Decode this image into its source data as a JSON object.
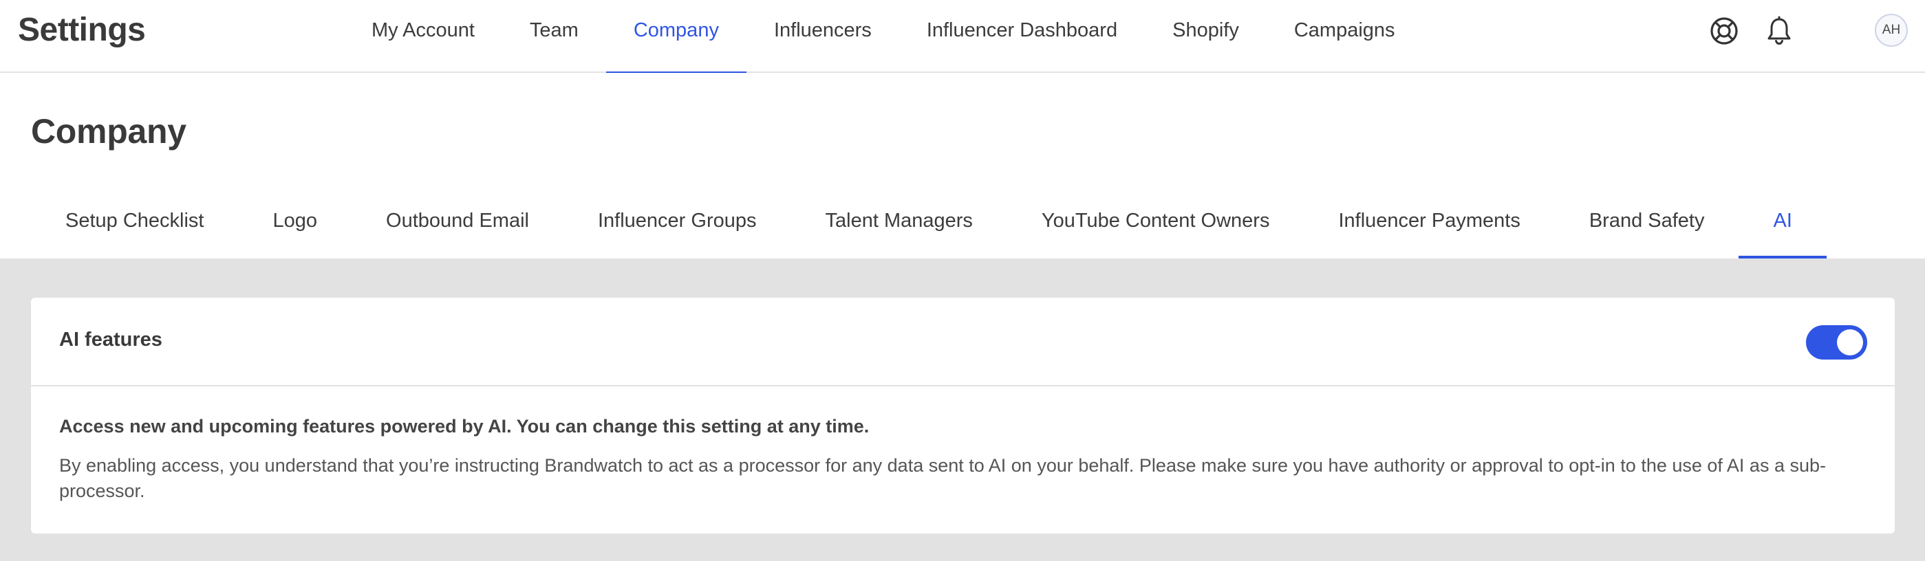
{
  "header": {
    "app_title": "Settings",
    "nav": [
      {
        "label": "My Account",
        "active": false
      },
      {
        "label": "Team",
        "active": false
      },
      {
        "label": "Company",
        "active": true
      },
      {
        "label": "Influencers",
        "active": false
      },
      {
        "label": "Influencer Dashboard",
        "active": false
      },
      {
        "label": "Shopify",
        "active": false
      },
      {
        "label": "Campaigns",
        "active": false
      }
    ],
    "icons": [
      "help-icon",
      "bell-icon"
    ],
    "avatar_initials": "AH"
  },
  "page": {
    "title": "Company",
    "tabs": [
      {
        "label": "Setup Checklist",
        "active": false
      },
      {
        "label": "Logo",
        "active": false
      },
      {
        "label": "Outbound Email",
        "active": false
      },
      {
        "label": "Influencer Groups",
        "active": false
      },
      {
        "label": "Talent Managers",
        "active": false
      },
      {
        "label": "YouTube Content Owners",
        "active": false
      },
      {
        "label": "Influencer Payments",
        "active": false
      },
      {
        "label": "Brand Safety",
        "active": false
      },
      {
        "label": "AI",
        "active": true
      }
    ]
  },
  "ai_card": {
    "title": "AI features",
    "enabled": true,
    "lead": "Access new and upcoming features powered by AI. You can change this setting at any time.",
    "description": "By enabling access, you understand that you’re instructing Brandwatch to act as a processor for any data sent to AI on your behalf. Please make sure you have authority or approval to opt-in to the use of AI as a sub-processor."
  },
  "colors": {
    "accent": "#2f55e4",
    "page_background": "#e2e2e2",
    "surface": "#ffffff",
    "text": "#3a3a3a"
  }
}
